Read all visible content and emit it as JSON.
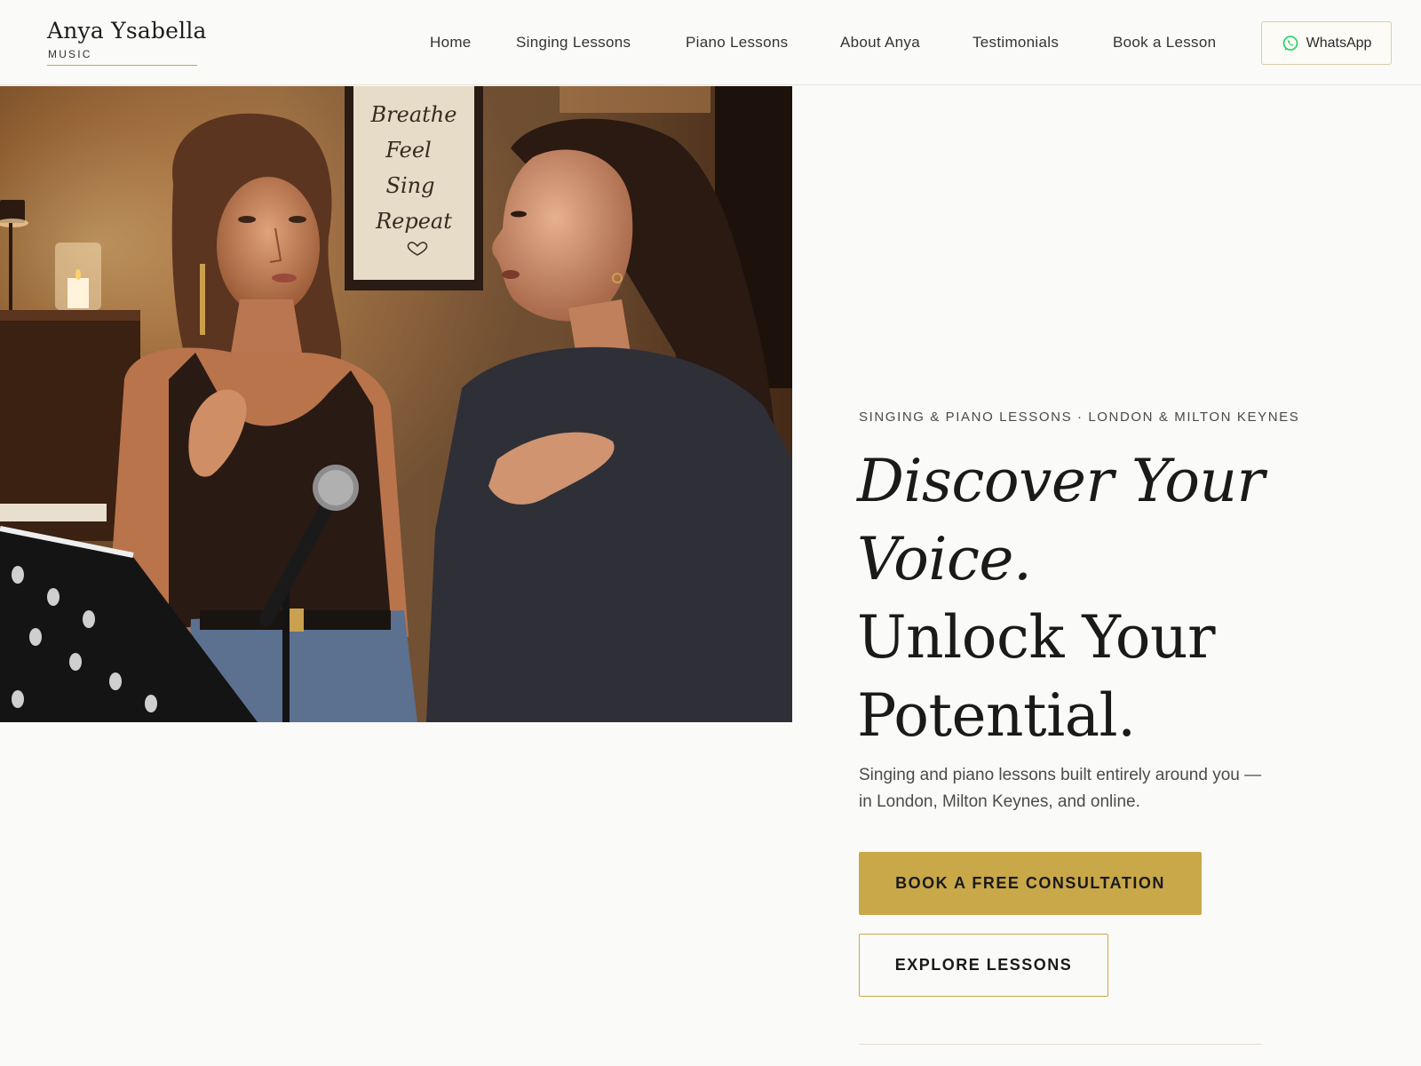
{
  "brand": {
    "name": "Anya Ysabella",
    "sub": "MUSIC"
  },
  "nav": {
    "items": [
      {
        "label": "Home"
      },
      {
        "label": "Singing Lessons"
      },
      {
        "label": "Piano Lessons"
      },
      {
        "label": "About Anya"
      },
      {
        "label": "Testimonials"
      },
      {
        "label": "Book a Lesson"
      }
    ],
    "whatsapp_label": "WhatsApp"
  },
  "hero": {
    "poster_text": [
      "Breathe",
      "Feel",
      "Sing",
      "Repeat"
    ],
    "eyebrow": "SINGING & PIANO LESSONS · LONDON & MILTON KEYNES",
    "headline": {
      "line1": "Discover Your",
      "line2": "Voice.",
      "line3": "Unlock Your",
      "line4": "Potential."
    },
    "subtext": "Singing and piano lessons built entirely around you — in London, Milton Keynes, and online.",
    "primary_cta": "BOOK A FREE CONSULTATION",
    "secondary_cta": "EXPLORE LESSONS"
  },
  "colors": {
    "accent_gold": "#c9a84a",
    "background": "#fafaf8",
    "text_dark": "#1a1a1a",
    "whatsapp_green": "#25d366"
  },
  "icons": {
    "whatsapp": "whatsapp-icon"
  }
}
